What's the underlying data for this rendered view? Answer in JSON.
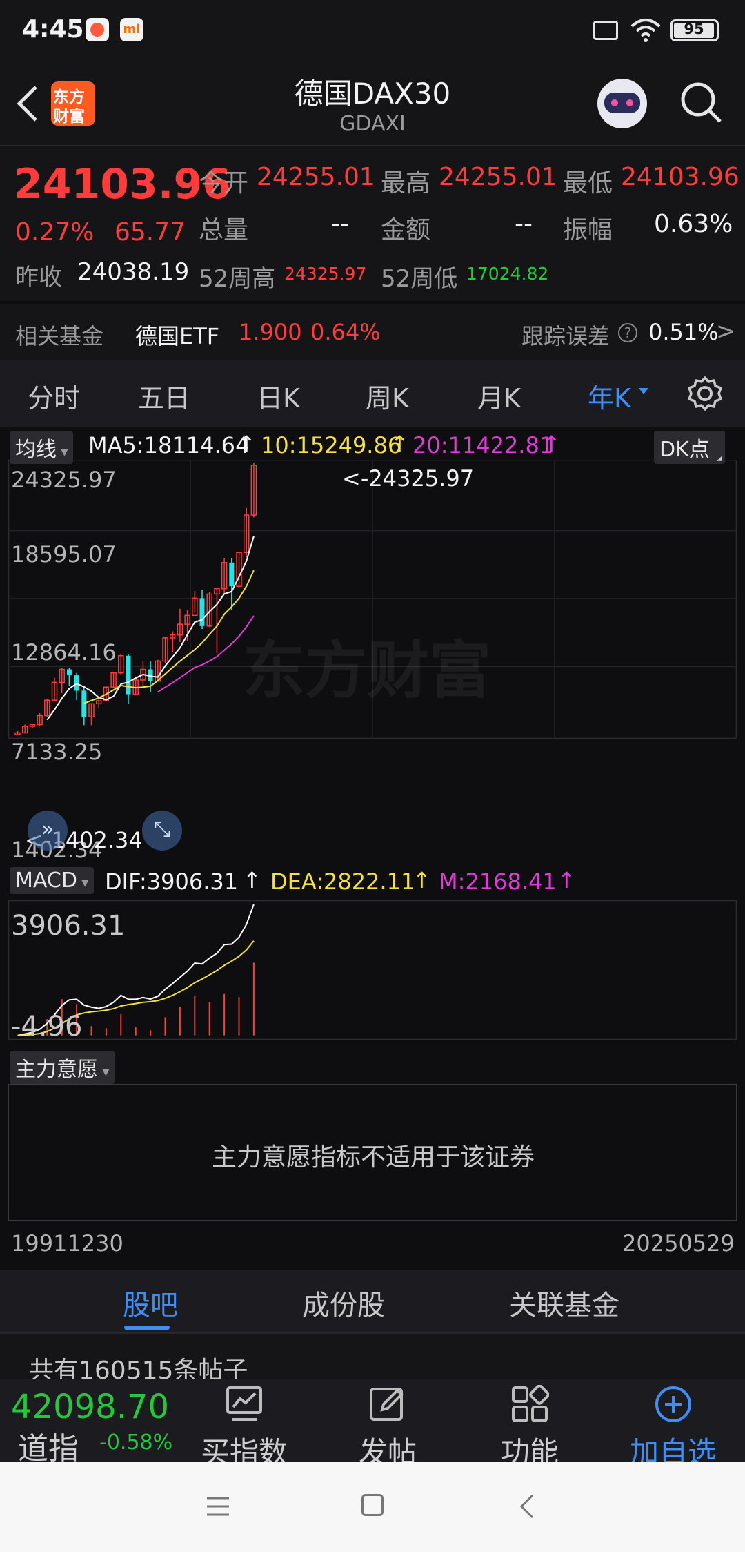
{
  "status": {
    "time": "4:45",
    "battery": "95"
  },
  "header": {
    "logo_text_1": "东方",
    "logo_text_2": "财富",
    "title": "德国DAX30",
    "subtitle": "GDAXI"
  },
  "quote": {
    "price": "24103.96",
    "change_pct": "0.27%",
    "change_val": "65.77",
    "open_label": "今开",
    "open_value": "24255.01",
    "high_label": "最高",
    "high_value": "24255.01",
    "low_label": "最低",
    "low_value": "24103.96",
    "volume_label": "总量",
    "volume_value": "--",
    "amount_label": "金额",
    "amount_value": "--",
    "amplitude_label": "振幅",
    "amplitude_value": "0.63%",
    "prev_close_label": "昨收",
    "prev_close_value": "24038.19",
    "w52_high_label": "52周高",
    "w52_high_value": "24325.97",
    "w52_low_label": "52周低",
    "w52_low_value": "17024.82"
  },
  "fund": {
    "label": "相关基金",
    "name": "德国ETF",
    "price": "1.900",
    "pct": "0.64%",
    "tracking_label": "跟踪误差",
    "tracking_value": "0.51%",
    "arrow": ">"
  },
  "period_tabs": {
    "fenshi": "分时",
    "wuri": "五日",
    "rik": "日K",
    "zhouk": "周K",
    "yuek": "月K",
    "niank": "年K"
  },
  "chart": {
    "ma_tag": "均线",
    "ma5": "MA5:18114.64",
    "ma10": "10:15249.86",
    "ma20": "20:11422.81",
    "dk_tag": "DK点",
    "y_labels": [
      "24325.97",
      "18595.07",
      "12864.16",
      "7133.25",
      "1402.34"
    ],
    "max_marker": "<-24325.97",
    "min_marker": "<-1402.34",
    "watermark": "东方财富",
    "macd_tag": "MACD",
    "dif": "DIF:3906.31",
    "dea": "DEA:2822.11",
    "m": "M:2168.41",
    "macd_top": "3906.31",
    "macd_bottom": "-4.96",
    "zl_tag": "主力意愿",
    "zl_message": "主力意愿指标不适用于该证券",
    "date_start": "19911230",
    "date_end": "20250529",
    "colors": {
      "up": "#ff3b3b",
      "down": "#23e5e5",
      "ma5": "#ffffff",
      "ma10": "#f5e13c",
      "ma20": "#e23ad6"
    }
  },
  "chart_data": {
    "type": "candlestick",
    "period": "yearly",
    "x_range": [
      "19911230",
      "20250529"
    ],
    "ylim": [
      1402.34,
      24325.97
    ],
    "candles": [
      {
        "o": 1400,
        "c": 1550,
        "h": 1700,
        "l": 1402
      },
      {
        "o": 1550,
        "c": 2100,
        "h": 2250,
        "l": 1500
      },
      {
        "o": 2100,
        "c": 2250,
        "h": 2300,
        "l": 1950
      },
      {
        "o": 2250,
        "c": 3000,
        "h": 3200,
        "l": 2150
      },
      {
        "o": 3000,
        "c": 4300,
        "h": 4400,
        "l": 2900
      },
      {
        "o": 4300,
        "c": 5800,
        "h": 6200,
        "l": 4200
      },
      {
        "o": 5800,
        "c": 6900,
        "h": 7000,
        "l": 4900
      },
      {
        "o": 6900,
        "c": 6400,
        "h": 7000,
        "l": 5500
      },
      {
        "o": 6400,
        "c": 5100,
        "h": 6600,
        "l": 4300
      },
      {
        "o": 5100,
        "c": 2900,
        "h": 5300,
        "l": 2200
      },
      {
        "o": 2900,
        "c": 4000,
        "h": 4000,
        "l": 2200
      },
      {
        "o": 4000,
        "c": 4250,
        "h": 4350,
        "l": 3600
      },
      {
        "o": 4250,
        "c": 5400,
        "h": 5450,
        "l": 4200
      },
      {
        "o": 5400,
        "c": 6600,
        "h": 6650,
        "l": 5300
      },
      {
        "o": 6600,
        "c": 8050,
        "h": 8150,
        "l": 6400
      },
      {
        "o": 8050,
        "c": 4800,
        "h": 8150,
        "l": 4000
      },
      {
        "o": 4800,
        "c": 6000,
        "h": 6150,
        "l": 4700
      },
      {
        "o": 6000,
        "c": 6900,
        "h": 7600,
        "l": 5400
      },
      {
        "o": 6900,
        "c": 5900,
        "h": 7600,
        "l": 5000
      },
      {
        "o": 5900,
        "c": 7600,
        "h": 7700,
        "l": 5900
      },
      {
        "o": 7600,
        "c": 9550,
        "h": 9600,
        "l": 7450
      },
      {
        "o": 9550,
        "c": 9800,
        "h": 10100,
        "l": 8350
      },
      {
        "o": 9800,
        "c": 10700,
        "h": 12000,
        "l": 9200
      },
      {
        "o": 10700,
        "c": 11450,
        "h": 11900,
        "l": 9300
      },
      {
        "o": 11450,
        "c": 12900,
        "h": 13500,
        "l": 11700
      },
      {
        "o": 12900,
        "c": 10550,
        "h": 13600,
        "l": 10300
      },
      {
        "o": 10550,
        "c": 13250,
        "h": 13450,
        "l": 10450
      },
      {
        "o": 13250,
        "c": 13700,
        "h": 13800,
        "l": 8250
      },
      {
        "o": 13700,
        "c": 15900,
        "h": 16300,
        "l": 13300
      },
      {
        "o": 15900,
        "c": 13900,
        "h": 16300,
        "l": 11900
      },
      {
        "o": 13900,
        "c": 16750,
        "h": 16800,
        "l": 13800
      },
      {
        "o": 16750,
        "c": 19900,
        "h": 20500,
        "l": 16350
      },
      {
        "o": 19900,
        "c": 24100,
        "h": 24326,
        "l": 19700
      }
    ],
    "ma5_end": 18114.64,
    "ma10_end": 15249.86,
    "ma20_end": 11422.81,
    "macd": {
      "dif": 3906.31,
      "dea": 2822.11,
      "m": 2168.41,
      "ylim": [
        -4.96,
        3906.31
      ]
    }
  },
  "content_tabs": {
    "guba": "股吧",
    "chengfen": "成份股",
    "guanlian": "关联基金"
  },
  "posts": {
    "count_text": "共有160515条帖子"
  },
  "bottom_bar": {
    "index_price": "42098.70",
    "index_name": "道指",
    "index_pct": "-0.58%",
    "buy_index": "买指数",
    "post": "发帖",
    "functions": "功能",
    "add_watch": "加自选"
  }
}
